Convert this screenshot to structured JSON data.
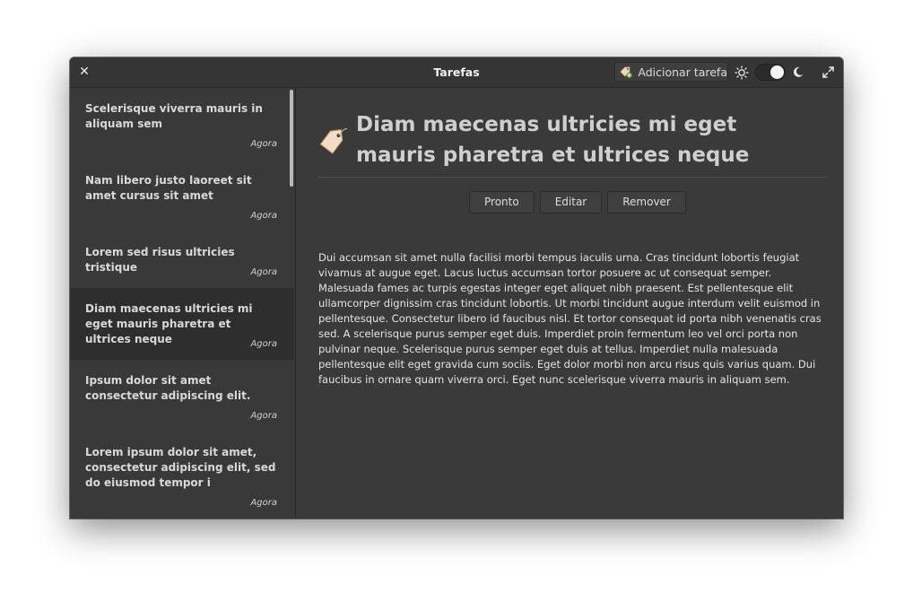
{
  "window": {
    "title": "Tarefas"
  },
  "header": {
    "add_task_label": "Adicionar tarefa"
  },
  "sidebar": {
    "items": [
      {
        "title": "Scelerisque viverra mauris in aliquam sem",
        "time": "Agora"
      },
      {
        "title": "Nam libero justo laoreet sit amet cursus sit amet",
        "time": "Agora"
      },
      {
        "title": "Lorem sed risus ultricies tristique",
        "time": "Agora"
      },
      {
        "title": "Diam maecenas ultricies mi eget mauris pharetra et ultrices neque",
        "time": "Agora"
      },
      {
        "title": "Ipsum dolor sit amet consectetur adipiscing elit.",
        "time": "Agora"
      },
      {
        "title": "Lorem ipsum dolor sit amet, consectetur adipiscing elit, sed do eiusmod tempor i",
        "time": "Agora"
      }
    ],
    "selected_index": 3
  },
  "detail": {
    "title": "Diam maecenas ultricies mi eget mauris pharetra et ultrices neque",
    "actions": {
      "done": "Pronto",
      "edit": "Editar",
      "remove": "Remover"
    },
    "body": "Dui accumsan sit amet nulla facilisi morbi tempus iaculis urna. Cras tincidunt lobortis feugiat vivamus at augue eget. Lacus luctus accumsan tortor posuere ac ut consequat semper. Malesuada fames ac turpis egestas integer eget aliquet nibh praesent. Est pellentesque elit ullamcorper dignissim cras tincidunt lobortis. Ut morbi tincidunt augue interdum velit euismod in pellentesque. Consectetur libero id faucibus nisl. Et tortor consequat id porta nibh venenatis cras sed. A scelerisque purus semper eget duis. Imperdiet proin fermentum leo vel orci porta non pulvinar neque. Scelerisque purus semper eget duis at tellus. Imperdiet nulla malesuada pellentesque elit eget gravida cum sociis. Eget dolor morbi non arcu risus quis varius quam. Dui faucibus in ornare quam viverra orci. Eget nunc scelerisque viverra mauris in aliquam sem."
  },
  "theme": {
    "dark_mode": true,
    "accent": "#f2c9a0"
  },
  "icons": {
    "close": "close-icon",
    "add_task": "tag-add-icon",
    "sun": "sun-icon",
    "moon": "moon-icon",
    "maximize": "maximize-icon",
    "task_tag": "tag-icon"
  }
}
